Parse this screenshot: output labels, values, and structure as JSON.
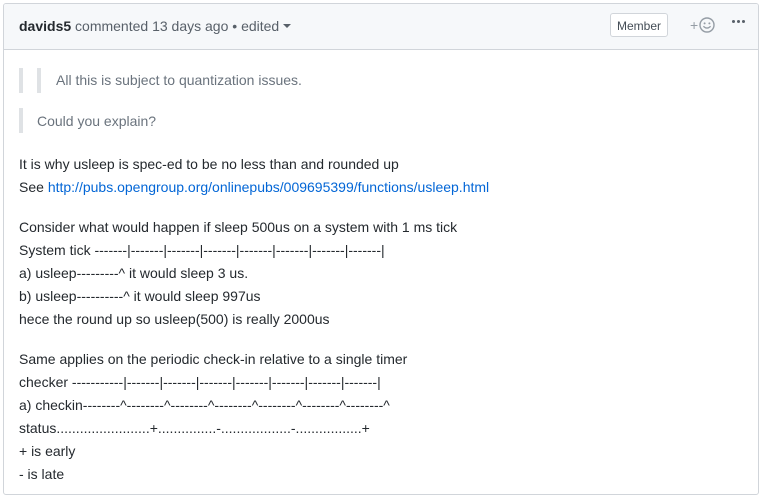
{
  "header": {
    "author": "davids5",
    "action": "commented",
    "time": "13 days ago",
    "separator": "•",
    "edited": "edited",
    "badge": "Member",
    "reaction_plus": "+"
  },
  "body": {
    "nested_quote": "All this is subject to quantization issues.",
    "quote": "Could you explain?",
    "para1": {
      "line1": "It is why usleep is spec-ed to be no less than and rounded up",
      "line2_prefix": "See ",
      "link": "http://pubs.opengroup.org/onlinepubs/009695399/functions/usleep.html"
    },
    "para2": [
      "Consider what would happen if sleep 500us on a system with 1 ms tick",
      "System tick -------|-------|-------|-------|-------|-------|-------|-------|",
      "a) usleep---------^ it would sleep 3 us.",
      "b) usleep----------^ it would sleep 997us",
      "hece the round up so usleep(500) is really 2000us"
    ],
    "para3": [
      "Same applies on the periodic check-in relative to a single timer",
      "checker -----------|-------|-------|-------|-------|-------|-------|-------|",
      "a) checkin--------^--------^--------^--------^--------^--------^--------^",
      "status........................+...............-..................-.................+",
      "+ is early",
      "- is late"
    ]
  }
}
